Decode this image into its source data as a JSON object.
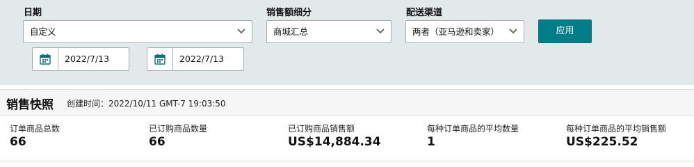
{
  "filters": {
    "date": {
      "label": "日期",
      "selected": "自定义",
      "start": "2022/7/13",
      "end": "2022/7/13"
    },
    "sales_breakdown": {
      "label": "销售额细分",
      "selected": "商城汇总"
    },
    "fulfillment": {
      "label": "配送渠道",
      "selected": "两者（亚马逊和卖家）"
    },
    "apply_label": "应用"
  },
  "snapshot": {
    "title": "销售快照",
    "created": "创建时间：2022/10/11 GMT-7 19:03:50",
    "metrics": [
      {
        "label": "订单商品总数",
        "value": "66"
      },
      {
        "label": "已订购商品数量",
        "value": "66"
      },
      {
        "label": "已订购商品销售额",
        "value": "US$14,884.34"
      },
      {
        "label": "每种订单商品的平均数量",
        "value": "1"
      },
      {
        "label": "每种订单商品的平均销售额",
        "value": "US$225.52"
      }
    ]
  },
  "icons": {
    "calendar": "calendar-icon",
    "dropdown": "chevron-down-icon"
  },
  "colors": {
    "accent": "#007e88",
    "filter_bg": "#e3e8ea"
  }
}
